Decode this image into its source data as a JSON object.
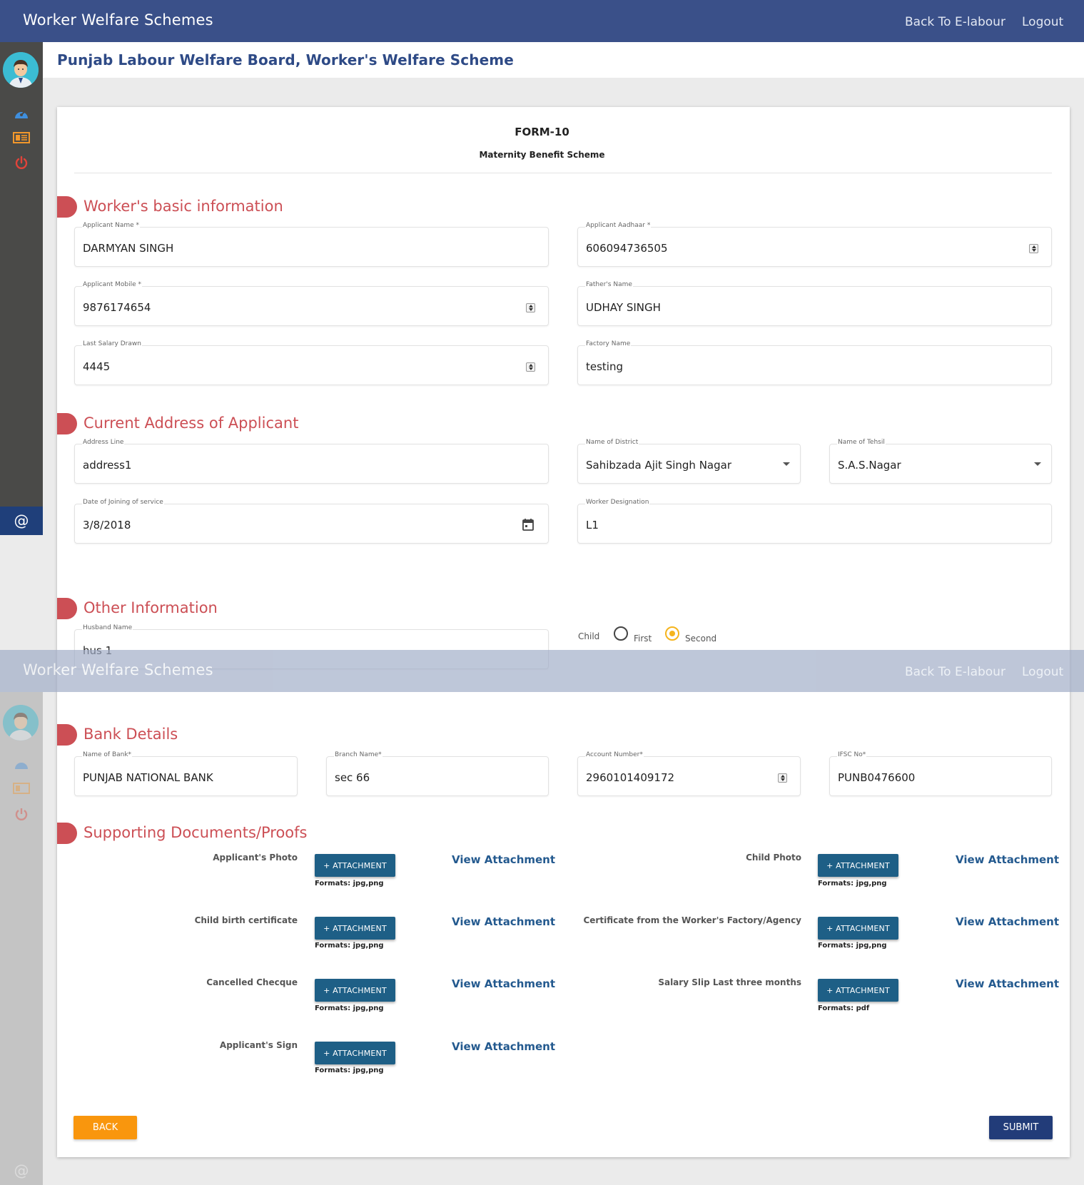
{
  "app": {
    "brand": "Worker Welfare Schemes",
    "back_link": "Back To E-labour",
    "logout_link": "Logout"
  },
  "page": {
    "title": "Punjab Labour Welfare Board, Worker's Welfare Scheme"
  },
  "form": {
    "number": "FORM-10",
    "scheme": "Maternity Benefit Scheme"
  },
  "sections": {
    "basic": "Worker's basic information",
    "address": "Current Address of Applicant",
    "other": "Other Information",
    "bank": "Bank Details",
    "docs": "Supporting Documents/Proofs"
  },
  "basic": {
    "applicant_name": {
      "label": "Applicant Name *",
      "value": "DARMYAN SINGH"
    },
    "aadhaar": {
      "label": "Applicant Aadhaar *",
      "value": "606094736505"
    },
    "mobile": {
      "label": "Applicant Mobile *",
      "value": "9876174654"
    },
    "father": {
      "label": "Father's Name",
      "value": "UDHAY SINGH"
    },
    "salary": {
      "label": "Last Salary Drawn",
      "value": "4445"
    },
    "factory": {
      "label": "Factory Name",
      "value": "testing"
    }
  },
  "address": {
    "line": {
      "label": "Address Line",
      "value": "address1"
    },
    "district": {
      "label": "Name of District",
      "value": "Sahibzada Ajit Singh Nagar"
    },
    "tehsil": {
      "label": "Name of Tehsil",
      "value": "S.A.S.Nagar"
    },
    "joining": {
      "label": "Date of Joining of service",
      "value": "3/8/2018"
    },
    "designation": {
      "label": "Worker Designation",
      "value": "L1"
    }
  },
  "other": {
    "husband": {
      "label": "Husband Name",
      "value": "hus 1"
    },
    "child": {
      "label": "Child",
      "options": [
        "First",
        "Second"
      ],
      "selected": "Second"
    }
  },
  "bank": {
    "bank_name": {
      "label": "Name of Bank*",
      "value": "PUNJAB NATIONAL BANK"
    },
    "branch": {
      "label": "Branch Name*",
      "value": "sec 66"
    },
    "account": {
      "label": "Account Number*",
      "value": "2960101409172"
    },
    "ifsc": {
      "label": "IFSC No*",
      "value": "PUNB0476600"
    }
  },
  "documents": {
    "attach_label": "+ ATTACHMENT",
    "view_label": "View Attachment",
    "items": [
      {
        "label": "Applicant's Photo",
        "formats": "Formats: jpg,png"
      },
      {
        "label": "Child Photo",
        "formats": "Formats: jpg,png"
      },
      {
        "label": "Child birth certificate",
        "formats": "Formats: jpg,png"
      },
      {
        "label": "Certificate from the Worker's Factory/Agency",
        "formats": "Formats: jpg,png"
      },
      {
        "label": "Cancelled Checque",
        "formats": "Formats: jpg,png"
      },
      {
        "label": "Salary Slip Last three months",
        "formats": "Formats: pdf"
      },
      {
        "label": "Applicant's Sign",
        "formats": "Formats: jpg,png"
      }
    ]
  },
  "actions": {
    "back": "BACK",
    "submit": "SUBMIT"
  },
  "sidebar": {
    "footer_symbol": "@"
  },
  "colors": {
    "navbar": "#3a5089",
    "section_accent": "#cc4f55",
    "attach_button": "#1e5f86",
    "back_button": "#f9960d",
    "submit_button": "#223c79",
    "radio_selected": "#f5b41d"
  },
  "icons": [
    "avatar",
    "dashboard-icon",
    "news-icon",
    "power-icon",
    "calendar-icon"
  ]
}
